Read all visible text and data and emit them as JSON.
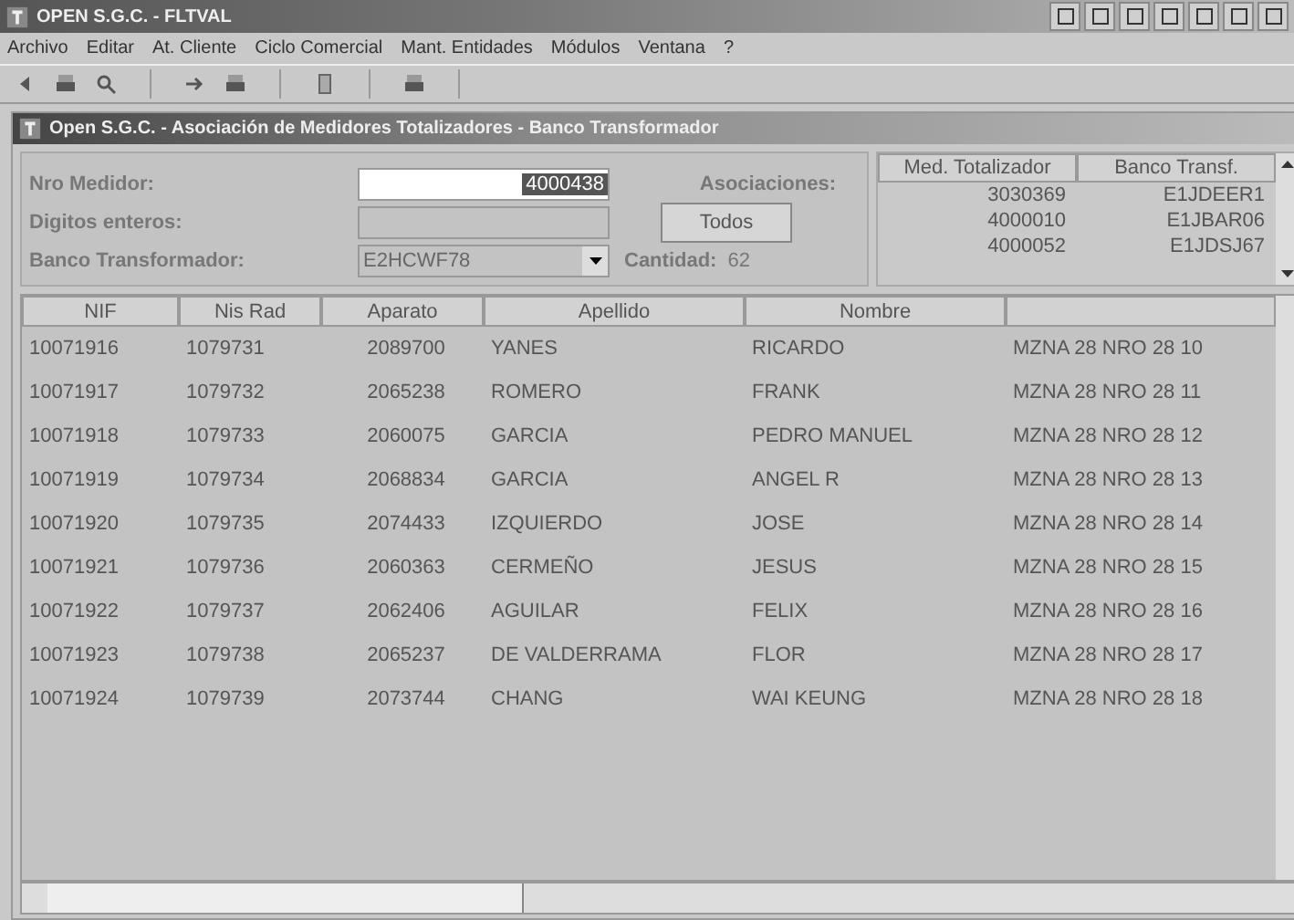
{
  "window": {
    "title": "OPEN S.G.C. - FLTVAL"
  },
  "menu": [
    {
      "label": "Archivo",
      "disabled": false
    },
    {
      "label": "Editar",
      "disabled": false
    },
    {
      "label": "At. Cliente",
      "disabled": false
    },
    {
      "label": "Ciclo Comercial",
      "disabled": false
    },
    {
      "label": "Mant. Entidades",
      "disabled": false
    },
    {
      "label": "Módulos",
      "disabled": false
    },
    {
      "label": "Ventana",
      "disabled": false
    },
    {
      "label": "?",
      "disabled": false
    }
  ],
  "child_window": {
    "title": "Open S.G.C. - Asociación de Medidores Totalizadores - Banco Transformador"
  },
  "form": {
    "nro_medidor": {
      "label": "Nro Medidor:",
      "value": "4000438"
    },
    "digitos_enteros": {
      "label": "Digitos enteros:"
    },
    "banco_transformador": {
      "label": "Banco Transformador:",
      "value": "E2HCWF78"
    },
    "asociaciones_label": "Asociaciones:",
    "todos_button": "Todos",
    "cantidad_label": "Cantidad:",
    "cantidad": "62"
  },
  "associations": {
    "columns": [
      "Med. Totalizador",
      "Banco Transf."
    ],
    "rows": [
      [
        "3030369",
        "E1JDEER1"
      ],
      [
        "4000010",
        "E1JBAR06"
      ],
      [
        "4000052",
        "E1JDSJ67"
      ]
    ]
  },
  "table": {
    "columns": [
      "NIF",
      "Nis Rad",
      "Aparato",
      "Apellido",
      "Nombre"
    ],
    "rows": [
      [
        "10071916",
        "1079731",
        "2089700",
        "YANES",
        "RICARDO",
        "MZNA 28 NRO 28 10"
      ],
      [
        "10071917",
        "1079732",
        "2065238",
        "ROMERO",
        "FRANK",
        "MZNA 28 NRO 28 11"
      ],
      [
        "10071918",
        "1079733",
        "2060075",
        "GARCIA",
        "PEDRO MANUEL",
        "MZNA 28 NRO 28 12"
      ],
      [
        "10071919",
        "1079734",
        "2068834",
        "GARCIA",
        "ANGEL R",
        "MZNA 28 NRO 28 13"
      ],
      [
        "10071920",
        "1079735",
        "2074433",
        "IZQUIERDO",
        "JOSE",
        "MZNA 28 NRO 28 14"
      ],
      [
        "10071921",
        "1079736",
        "2060363",
        "CERMEÑO",
        "JESUS",
        "MZNA 28 NRO 28 15"
      ],
      [
        "10071922",
        "1079737",
        "2062406",
        "AGUILAR",
        "FELIX",
        "MZNA 28 NRO 28 16"
      ],
      [
        "10071923",
        "1079738",
        "2065237",
        "DE VALDERRAMA",
        "FLOR",
        "MZNA 28 NRO 28 17"
      ],
      [
        "10071924",
        "1079739",
        "2073744",
        "CHANG",
        "WAI KEUNG",
        "MZNA 28 NRO 28 18"
      ]
    ]
  }
}
